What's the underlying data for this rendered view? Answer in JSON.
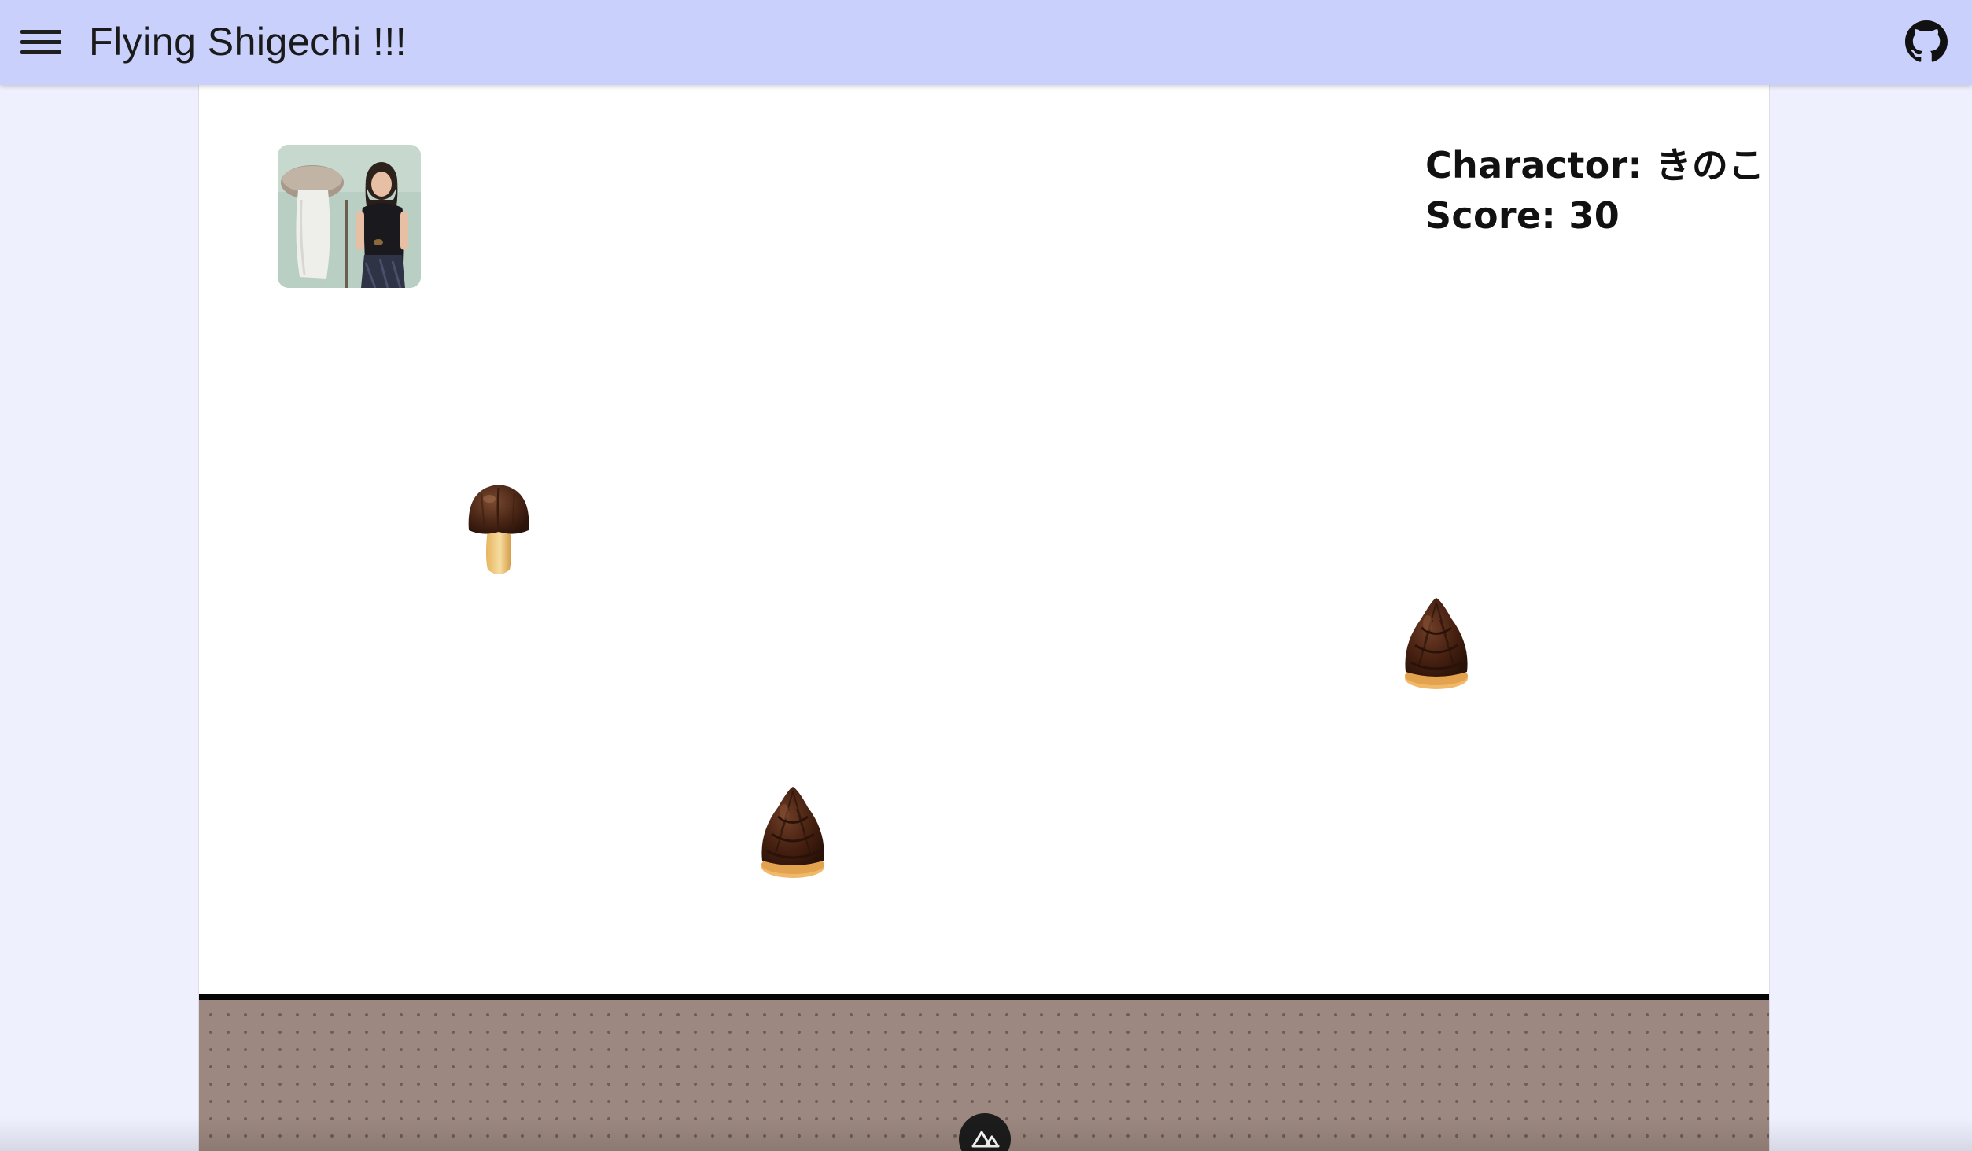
{
  "header": {
    "title": "Flying Shigechi !!!",
    "menu_icon": "hamburger-menu-icon",
    "github_icon": "github-icon",
    "background": "#c8d0fb"
  },
  "game": {
    "charactor_label": "Charactor:",
    "charactor_value": "きのこ",
    "score_label": "Score:",
    "score_value": "30",
    "player_image": "photo of person beside a giant mushroom",
    "items": [
      {
        "type": "kinoko",
        "name": "mushroom-chocolate"
      },
      {
        "type": "takenoko",
        "name": "bamboo-shoot-chocolate"
      },
      {
        "type": "takenoko",
        "name": "bamboo-shoot-chocolate"
      }
    ],
    "ground_color": "#9c8880"
  },
  "footer": {
    "badge_icon": "nuxt-logo-icon"
  }
}
